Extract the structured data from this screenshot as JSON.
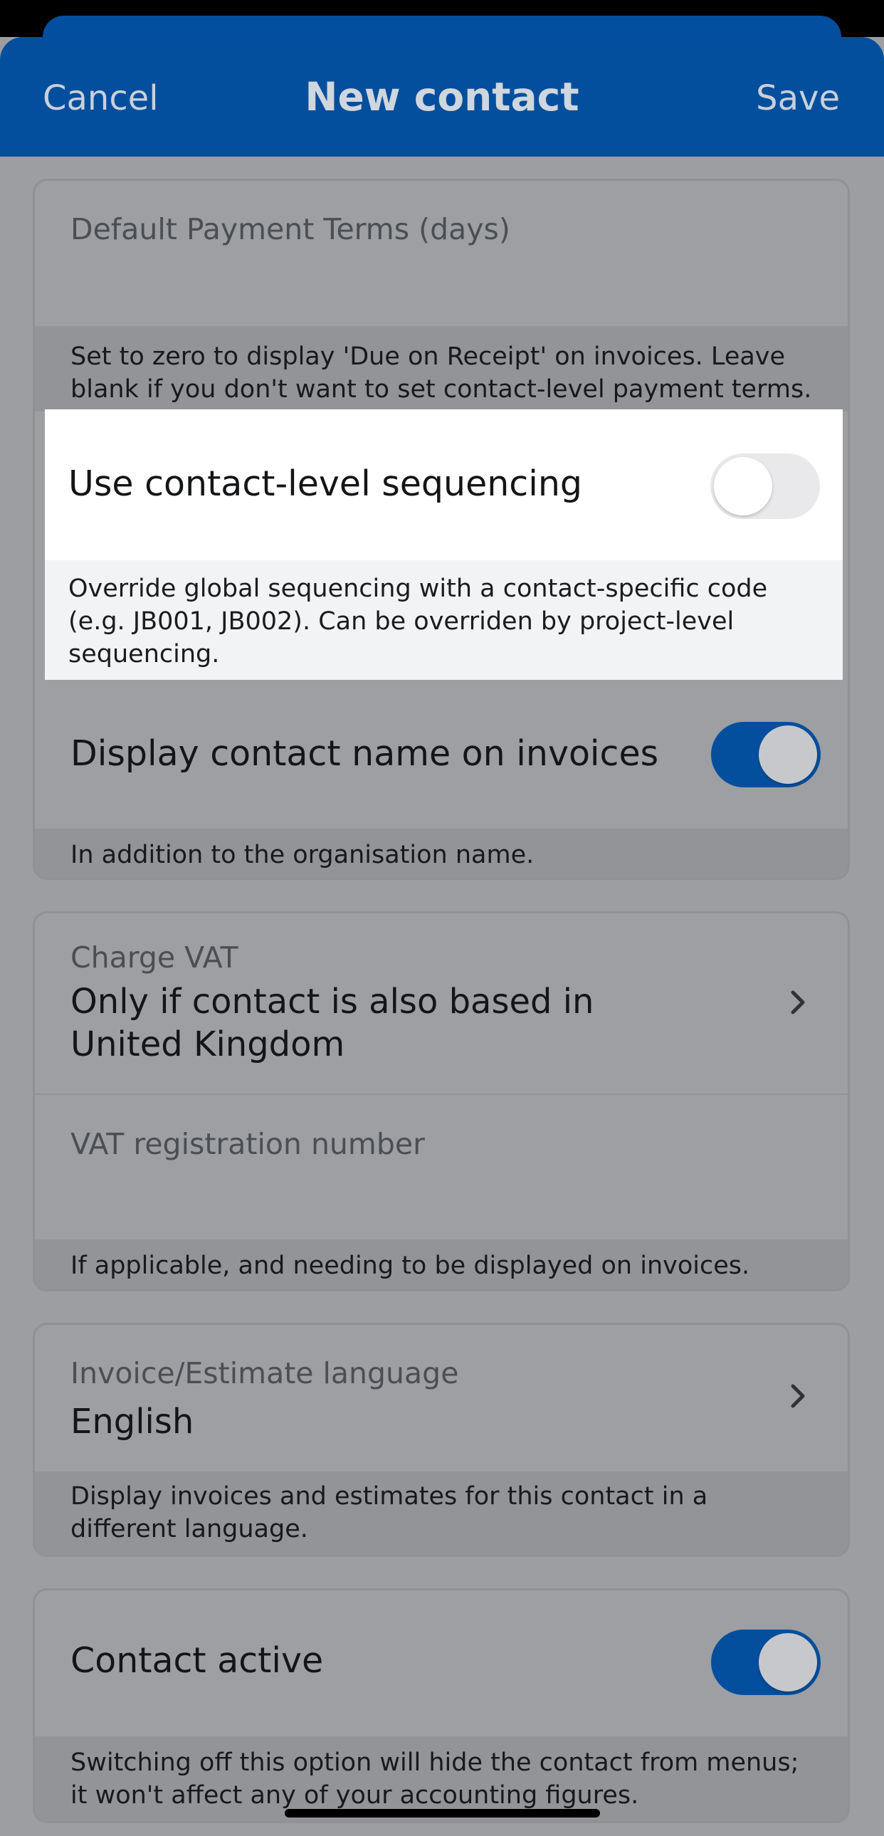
{
  "nav": {
    "cancel": "Cancel",
    "title": "New contact",
    "save": "Save"
  },
  "payment_terms": {
    "label": "Default Payment Terms (days)",
    "value": "",
    "footer": "Set to zero to display 'Due on Receipt' on invoices. Leave blank if you don't want to set contact-level payment terms."
  },
  "sequencing": {
    "label": "Use contact-level sequencing",
    "enabled": false,
    "footer": "Override global sequencing with a contact-specific code (e.g. JB001, JB002). Can be overriden by project-level sequencing."
  },
  "display_name": {
    "label": "Display contact name on invoices",
    "enabled": true,
    "footer": "In addition to the organisation name."
  },
  "vat": {
    "charge_label": "Charge VAT",
    "charge_value_line1": "Only if contact is also based in",
    "charge_value_line2": "United Kingdom",
    "reg_label": "VAT registration number",
    "reg_value": "",
    "footer": "If applicable, and needing to be displayed on invoices."
  },
  "language": {
    "label": "Invoice/Estimate language",
    "value": "English",
    "footer": "Display invoices and estimates for this contact in a different language."
  },
  "active": {
    "label": "Contact active",
    "enabled": true,
    "footer": "Switching off this option will hide the contact from menus; it won't affect any of your accounting figures."
  },
  "icons": {
    "chevron": "chevron-right-icon"
  },
  "colors": {
    "accent": "#034f9d",
    "toggle_off": "#e9e9eb"
  }
}
